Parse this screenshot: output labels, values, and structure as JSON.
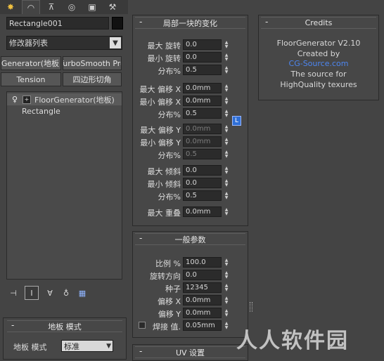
{
  "object_name": "Rectangle001",
  "modifier_list": "修改器列表",
  "modifier_buttons": [
    "oorGenerator(地板",
    "TurboSmooth Pro",
    "Tension",
    "四边形切角"
  ],
  "stack_items": [
    "FloorGenerator(地板)",
    "Rectangle"
  ],
  "random_rollout": {
    "title": "局部一块的变化",
    "params": [
      {
        "label": "最大 旋转",
        "value": "0.0",
        "disabled": false
      },
      {
        "label": "最小 旋转",
        "value": "0.0",
        "disabled": false
      },
      {
        "label": "分布%",
        "value": "0.5",
        "disabled": false
      },
      {
        "label": "最大 偏移 X",
        "value": "0.0mm",
        "disabled": false
      },
      {
        "label": "最小 偏移 X",
        "value": "0.0mm",
        "disabled": false
      },
      {
        "label": "分布%",
        "value": "0.5",
        "disabled": false
      },
      {
        "label": "最大 偏移 Y",
        "value": "0.0mm",
        "disabled": true
      },
      {
        "label": "最小 偏移 Y",
        "value": "0.0mm",
        "disabled": true
      },
      {
        "label": "分布%",
        "value": "0.5",
        "disabled": true
      },
      {
        "label": "最大 倾斜",
        "value": "0.0",
        "disabled": false
      },
      {
        "label": "最小 倾斜",
        "value": "0.0",
        "disabled": false
      },
      {
        "label": "分布%",
        "value": "0.5",
        "disabled": false
      },
      {
        "label": "最大 重叠",
        "value": "0.0mm",
        "disabled": false
      }
    ],
    "lock_button": "L"
  },
  "general_rollout": {
    "title": "一般参数",
    "params": [
      {
        "label": "比例 %",
        "value": "100.0"
      },
      {
        "label": "旋转方向",
        "value": "0.0"
      },
      {
        "label": "种子",
        "value": "12345"
      },
      {
        "label": "偏移 X",
        "value": "0.0mm"
      },
      {
        "label": "偏移 Y",
        "value": "0.0mm"
      },
      {
        "label": "焊接 值.",
        "value": "0.05mm"
      }
    ]
  },
  "uv_rollout": {
    "title": "UV 设置"
  },
  "floor_mode_rollout": {
    "title": "地板 模式",
    "label": "地板 模式",
    "value": "标准"
  },
  "credits": {
    "title": "Credits",
    "lines": [
      "FloorGenerator V2.10",
      "Created by",
      "CG-Source.com",
      "The source for",
      "HighQuality texures"
    ],
    "link_color": "#2b6ee8"
  },
  "watermark": "人人软件园"
}
